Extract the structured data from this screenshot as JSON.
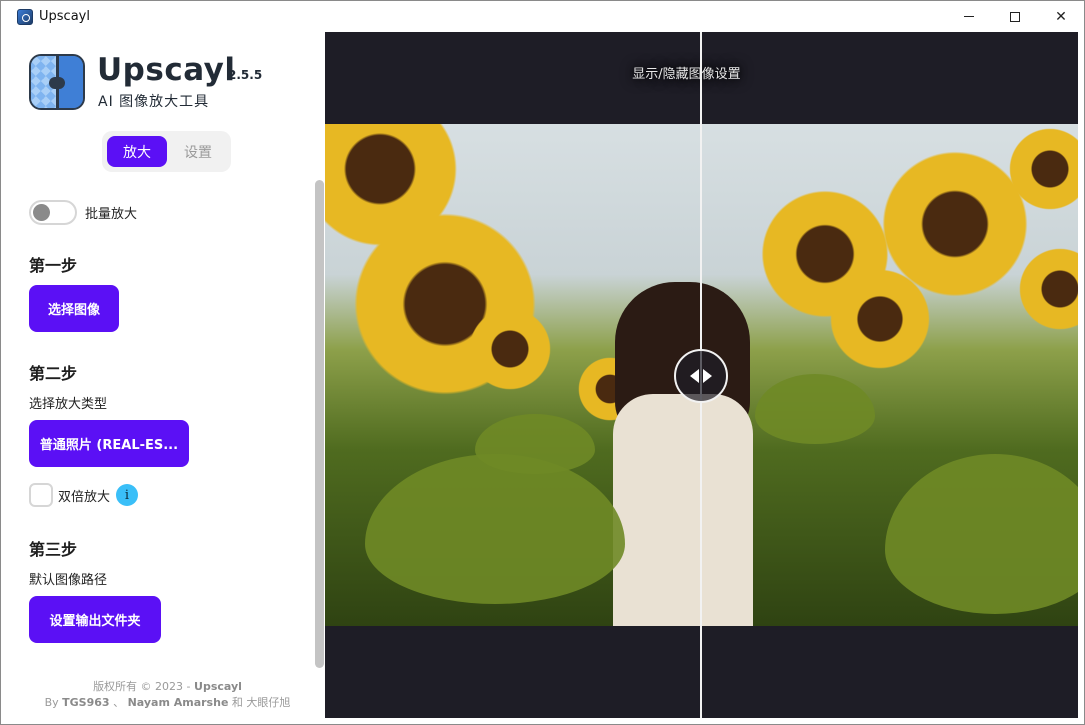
{
  "window": {
    "title": "Upscayl"
  },
  "brand": {
    "name": "Upscayl",
    "version": "2.5.5",
    "subtitle": "AI 图像放大工具"
  },
  "tabs": [
    {
      "label": "放大",
      "active": true
    },
    {
      "label": "设置",
      "active": false
    }
  ],
  "batch": {
    "label": "批量放大",
    "enabled": false
  },
  "steps": {
    "step1": {
      "title": "第一步",
      "button": "选择图像"
    },
    "step2": {
      "title": "第二步",
      "subtitle": "选择放大类型",
      "button": "普通照片 (REAL-ES...",
      "double_label": "双倍放大",
      "double_checked": false,
      "info_glyph": "i"
    },
    "step3": {
      "title": "第三步",
      "subtitle": "默认图像路径",
      "button": "设置输出文件夹"
    }
  },
  "footer": {
    "copyright_prefix": "版权所有 © 2023 -",
    "copyright_brand": "Upscayl",
    "credits_by": "By",
    "author1": "TGS963",
    "sep": "、",
    "author2": "Nayam Amarshe",
    "and": "和",
    "author3": "大眼仔旭"
  },
  "viewer": {
    "toggle_settings_label": "显示/隐藏图像设置",
    "compare_split_fraction": 0.5
  },
  "colors": {
    "accent": "#5b10f5",
    "viewer_bg": "#1e1d26",
    "info": "#3abff8"
  }
}
